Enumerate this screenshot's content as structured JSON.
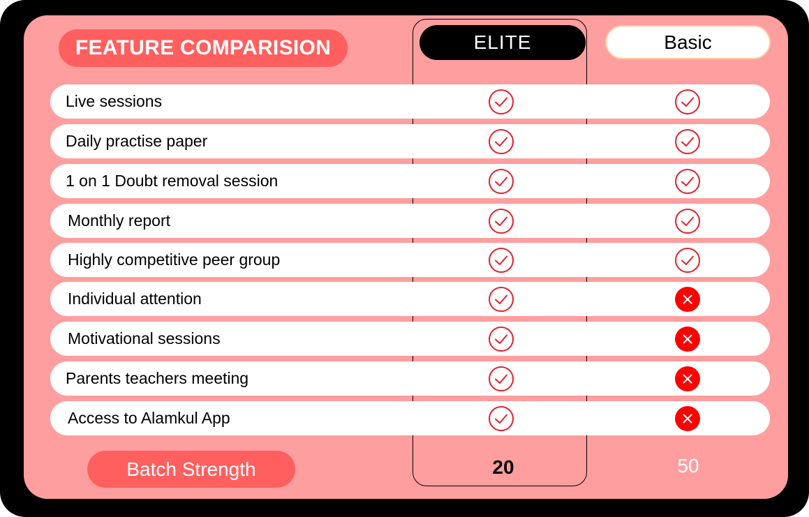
{
  "header": {
    "title": "FEATURE COMPARISION",
    "plans": [
      {
        "label": "ELITE"
      },
      {
        "label": "Basic"
      }
    ]
  },
  "features": [
    {
      "label": "Live sessions",
      "elite": "check-icon",
      "basic": "check-icon"
    },
    {
      "label": "Daily practise paper",
      "elite": "check-icon",
      "basic": "check-icon"
    },
    {
      "label": "1 on 1 Doubt removal session",
      "elite": "check-icon",
      "basic": "check-icon"
    },
    {
      "label": "Monthly report",
      "elite": "check-icon",
      "basic": "check-icon"
    },
    {
      "label": "Highly competitive peer group",
      "elite": "check-icon",
      "basic": "check-icon"
    },
    {
      "label": "Individual attention",
      "elite": "check-icon",
      "basic": "cross-icon"
    },
    {
      "label": "Motivational sessions",
      "elite": "check-icon",
      "basic": "cross-icon"
    },
    {
      "label": "Parents teachers meeting",
      "elite": "check-icon",
      "basic": "cross-icon"
    },
    {
      "label": "Access to Alamkul App",
      "elite": "check-icon",
      "basic": "cross-icon"
    }
  ],
  "footer": {
    "label": "Batch Strength",
    "elite_value": "20",
    "basic_value": "50"
  },
  "colors": {
    "background": "#ff9e9e",
    "accent": "#ff5f5f",
    "check": "#e5202a",
    "cross": "#ff0000"
  }
}
